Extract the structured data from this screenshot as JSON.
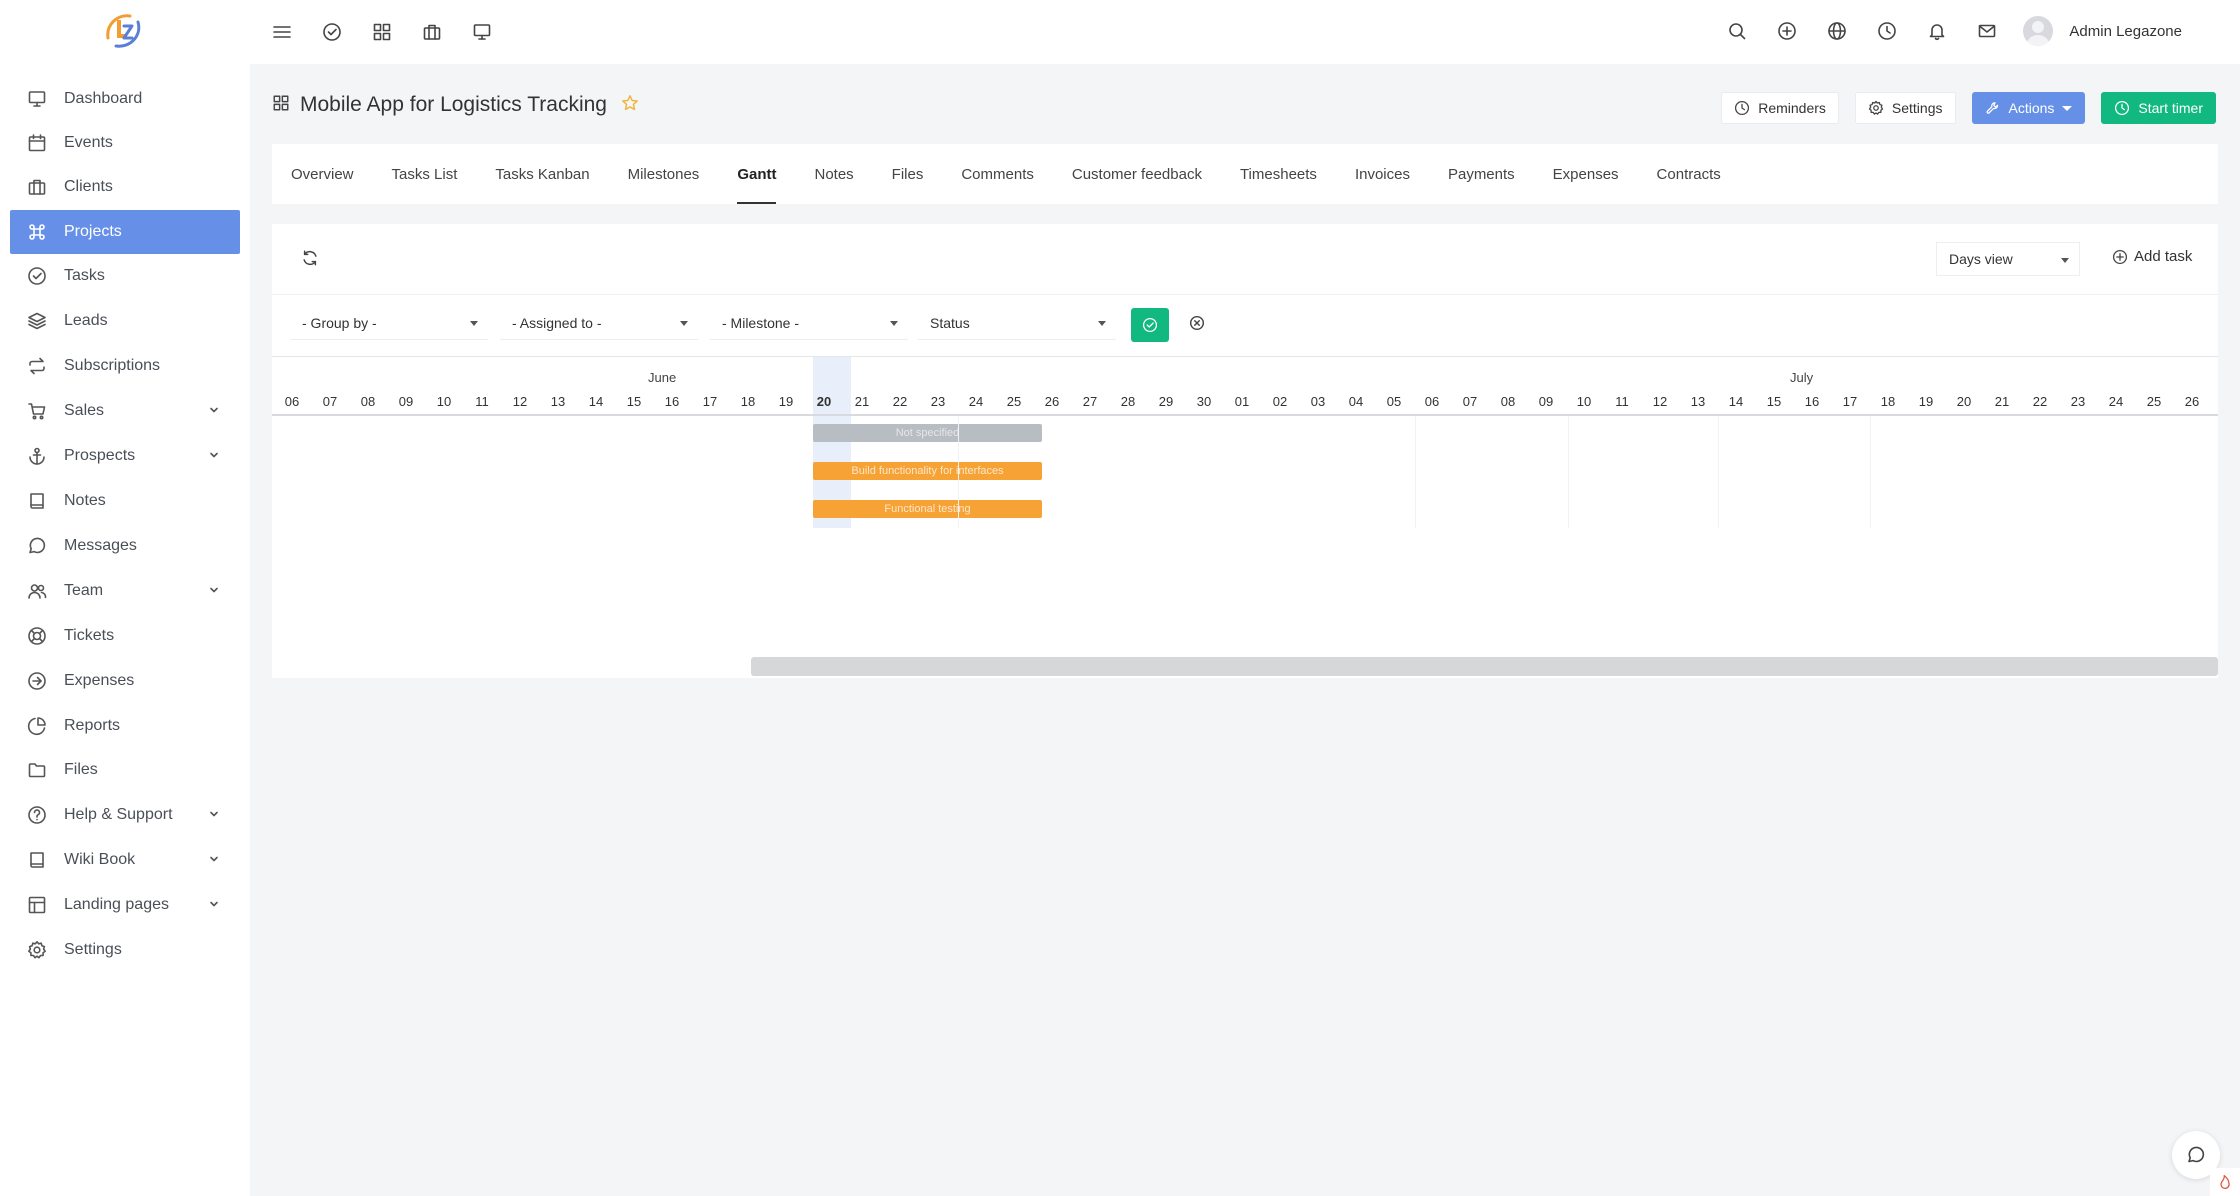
{
  "brand": {
    "logo_text": "LZ",
    "colors": {
      "primary": "#6690e8",
      "success": "#11b880",
      "bar_orange": "#f6a235",
      "bar_gray": "#b8bcc3"
    }
  },
  "topbar": {
    "left_icons": [
      "menu-icon",
      "check-circle-icon",
      "grid-icon",
      "briefcase-icon",
      "monitor-icon"
    ],
    "right_icons": [
      "search-icon",
      "plus-circle-icon",
      "globe-icon",
      "clock-icon",
      "bell-icon",
      "mail-icon"
    ],
    "user_name": "Admin Legazone"
  },
  "sidebar": {
    "items": [
      {
        "label": "Dashboard",
        "icon": "monitor-icon"
      },
      {
        "label": "Events",
        "icon": "calendar-icon"
      },
      {
        "label": "Clients",
        "icon": "briefcase-icon"
      },
      {
        "label": "Projects",
        "icon": "command-icon",
        "active": true
      },
      {
        "label": "Tasks",
        "icon": "check-circle-icon"
      },
      {
        "label": "Leads",
        "icon": "layers-icon"
      },
      {
        "label": "Subscriptions",
        "icon": "repeat-icon"
      },
      {
        "label": "Sales",
        "icon": "cart-icon",
        "expandable": true
      },
      {
        "label": "Prospects",
        "icon": "anchor-icon",
        "expandable": true
      },
      {
        "label": "Notes",
        "icon": "book-icon"
      },
      {
        "label": "Messages",
        "icon": "message-icon"
      },
      {
        "label": "Team",
        "icon": "users-icon",
        "expandable": true
      },
      {
        "label": "Tickets",
        "icon": "life-buoy-icon"
      },
      {
        "label": "Expenses",
        "icon": "arrow-circle-icon"
      },
      {
        "label": "Reports",
        "icon": "pie-chart-icon"
      },
      {
        "label": "Files",
        "icon": "folder-icon"
      },
      {
        "label": "Help & Support",
        "icon": "help-circle-icon",
        "expandable": true
      },
      {
        "label": "Wiki Book",
        "icon": "book-icon",
        "expandable": true
      },
      {
        "label": "Landing pages",
        "icon": "layout-icon",
        "expandable": true
      },
      {
        "label": "Settings",
        "icon": "gear-icon"
      }
    ]
  },
  "project": {
    "title": "Mobile App for Logistics Tracking"
  },
  "header_buttons": {
    "reminders": "Reminders",
    "settings": "Settings",
    "actions": "Actions",
    "start_timer": "Start timer"
  },
  "tabs": [
    "Overview",
    "Tasks List",
    "Tasks Kanban",
    "Milestones",
    "Gantt",
    "Notes",
    "Files",
    "Comments",
    "Customer feedback",
    "Timesheets",
    "Invoices",
    "Payments",
    "Expenses",
    "Contracts"
  ],
  "active_tab": "Gantt",
  "gantt": {
    "view_select": "Days view",
    "add_task": "Add task",
    "filters": {
      "group_by": "- Group by -",
      "assigned_to": "- Assigned to -",
      "milestone": "- Milestone -",
      "status": "Status"
    },
    "months": [
      "June",
      "July"
    ],
    "days": [
      "06",
      "07",
      "08",
      "09",
      "10",
      "11",
      "12",
      "13",
      "14",
      "15",
      "16",
      "17",
      "18",
      "19",
      "20",
      "21",
      "22",
      "23",
      "24",
      "25",
      "26",
      "27",
      "28",
      "29",
      "30",
      "01",
      "02",
      "03",
      "04",
      "05",
      "06",
      "07",
      "08",
      "09",
      "10",
      "11",
      "12",
      "13",
      "14",
      "15",
      "16",
      "17",
      "18",
      "19",
      "20",
      "21",
      "22",
      "23",
      "24",
      "25",
      "26"
    ],
    "today": "20",
    "bars": [
      {
        "label": "Not specified",
        "start": "June 20",
        "end": "June 25",
        "color": "gray"
      },
      {
        "label": "Build functionality for interfaces",
        "start": "June 20",
        "end": "June 25",
        "color": "orange"
      },
      {
        "label": "Functional testing",
        "start": "June 20",
        "end": "June 25",
        "color": "orange"
      }
    ]
  }
}
